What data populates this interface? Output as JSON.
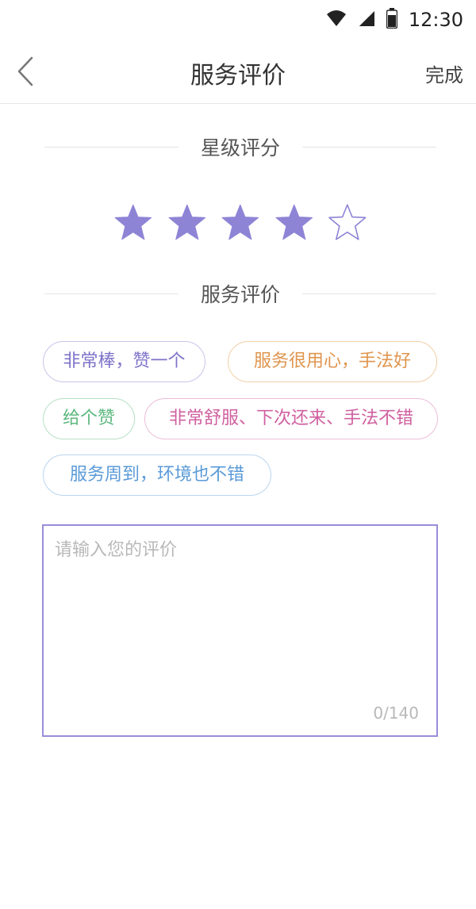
{
  "status_bar": {
    "time": "12:30",
    "icons": [
      "wifi-icon",
      "signal-icon",
      "battery-icon"
    ]
  },
  "nav": {
    "back_icon": "chevron-left-icon",
    "title": "服务评价",
    "done_label": "完成"
  },
  "rating": {
    "section_title": "星级评分",
    "value": 4,
    "max": 5,
    "active_color": "#8e84d6",
    "inactive_color": "#8e84d6"
  },
  "review": {
    "section_title": "服务评价",
    "tags": [
      {
        "label": "非常棒，赞一个",
        "color": "#7d72c9",
        "border": "#c9c4e8"
      },
      {
        "label": "服务很用心，手法好",
        "color": "#e0954e",
        "border": "#f0cfa8"
      },
      {
        "label": "给个赞",
        "color": "#5cb87e",
        "border": "#b7e0c5"
      },
      {
        "label": "非常舒服、下次还来、手法不错",
        "color": "#d060a0",
        "border": "#ecbdd8"
      },
      {
        "label": "服务周到，环境也不错",
        "color": "#5a9ad8",
        "border": "#b9d5ef"
      }
    ]
  },
  "comment": {
    "placeholder": "请输入您的评价",
    "value": "",
    "count": "0/140"
  }
}
